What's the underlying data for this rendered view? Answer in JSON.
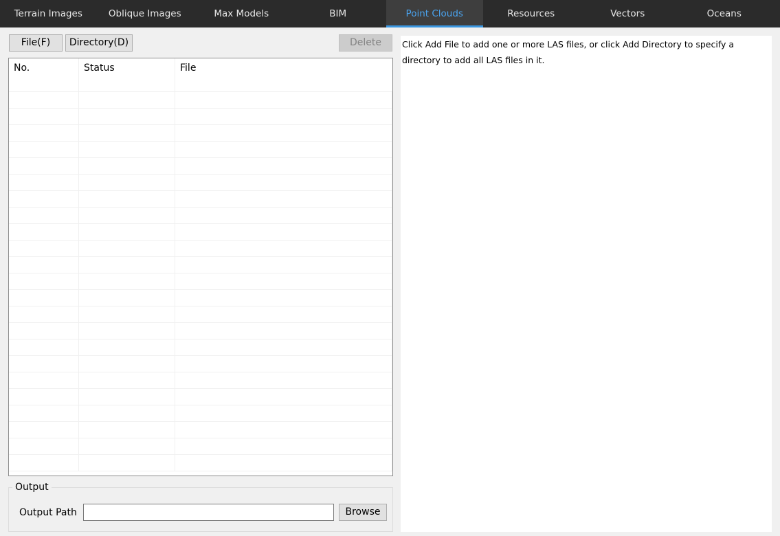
{
  "tabs": [
    {
      "label": "Terrain Images",
      "active": false
    },
    {
      "label": "Oblique Images",
      "active": false
    },
    {
      "label": "Max Models",
      "active": false
    },
    {
      "label": "BIM",
      "active": false
    },
    {
      "label": "Point Clouds",
      "active": true
    },
    {
      "label": "Resources",
      "active": false
    },
    {
      "label": "Vectors",
      "active": false
    },
    {
      "label": "Oceans",
      "active": false
    }
  ],
  "toolbar": {
    "file_label": "File(F)",
    "directory_label": "Directory(D)",
    "delete_label": "Delete"
  },
  "table": {
    "columns": [
      "No.",
      "Status",
      "File"
    ],
    "rows": []
  },
  "output": {
    "group_title": "Output",
    "path_label": "Output Path",
    "path_value": "",
    "browse_label": "Browse"
  },
  "help_text": "Click Add File to add one or more LAS files, or click Add Directory to specify a directory to add all LAS files in it.",
  "colors": {
    "tabbar_bg": "#2b2b2b",
    "active_tab_text": "#4aa3ee",
    "active_tab_underline": "#3a96e0",
    "panel_bg": "#f0f0f0"
  }
}
